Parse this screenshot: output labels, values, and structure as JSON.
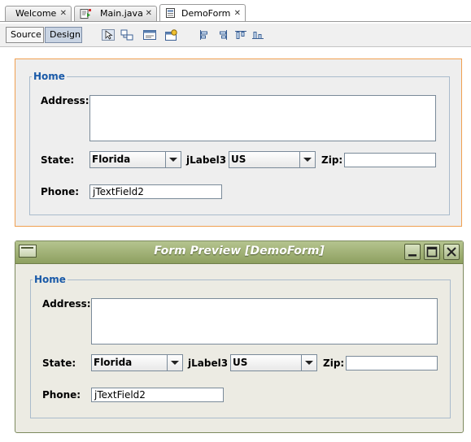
{
  "tabs": [
    {
      "label": "Welcome",
      "icon": "none"
    },
    {
      "label": "Main.java",
      "icon": "java-file-icon"
    },
    {
      "label": "DemoForm",
      "icon": "form-file-icon",
      "active": true
    }
  ],
  "toolbar": {
    "source_label": "Source",
    "design_label": "Design",
    "mode": "Design",
    "icons": [
      "selection-mode-icon",
      "connection-mode-icon",
      "preview-design-icon",
      "test-form-icon",
      "align-left-icon",
      "align-right-icon",
      "align-top-icon",
      "align-bottom-icon"
    ]
  },
  "form": {
    "panel_title": "Home",
    "address_label": "Address:",
    "address_value": "",
    "state_label": "State:",
    "state_value": "Florida",
    "jlabel3": "jLabel3",
    "country_value": "US",
    "zip_label": "Zip:",
    "zip_value": "",
    "phone_label": "Phone:",
    "phone_value": "jTextField2"
  },
  "preview": {
    "title": "Form Preview [DemoForm]"
  },
  "colors": {
    "selection_border": "#f0a050",
    "legend_text": "#1a5aa8",
    "preview_titlebar": "#9aab6c"
  }
}
